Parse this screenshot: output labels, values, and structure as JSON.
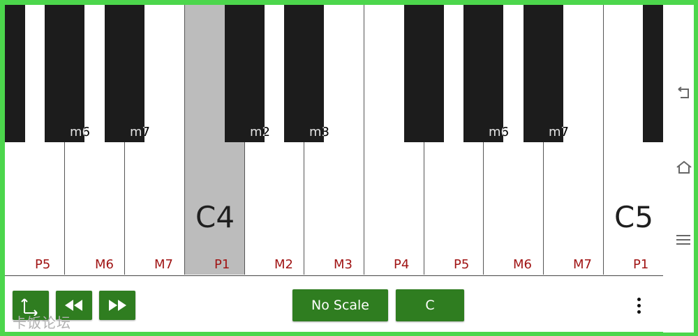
{
  "keyboard": {
    "white_keys": [
      {
        "interval": "P5",
        "note": "",
        "active": false
      },
      {
        "interval": "M6",
        "note": "",
        "active": false
      },
      {
        "interval": "M7",
        "note": "",
        "active": false
      },
      {
        "interval": "P1",
        "note": "C4",
        "active": true
      },
      {
        "interval": "M2",
        "note": "",
        "active": false
      },
      {
        "interval": "M3",
        "note": "",
        "active": false
      },
      {
        "interval": "P4",
        "note": "",
        "active": false
      },
      {
        "interval": "P5",
        "note": "",
        "active": false
      },
      {
        "interval": "M6",
        "note": "",
        "active": false
      },
      {
        "interval": "M7",
        "note": "",
        "active": false
      },
      {
        "interval": "P1",
        "note": "C5",
        "active": false
      }
    ],
    "black_keys": [
      {
        "interval": ""
      },
      {
        "interval": "m6"
      },
      {
        "interval": "m7"
      },
      {
        "interval": "m2"
      },
      {
        "interval": "m3"
      },
      {
        "interval": ""
      },
      {
        "interval": "m6"
      },
      {
        "interval": "m7"
      },
      {
        "interval": ""
      }
    ]
  },
  "toolbar": {
    "axis_button_icon": "axis-icon",
    "rewind_button_icon": "rewind-icon",
    "fast_forward_button_icon": "fast-forward-icon",
    "scale_label": "No Scale",
    "key_label": "C",
    "more_icon": "more-vert-icon"
  },
  "nav": {
    "back_icon": "back-icon",
    "home_icon": "home-icon",
    "menu_icon": "menu-icon"
  },
  "watermark": "卡饭论坛",
  "colors": {
    "frame": "#4cd64c",
    "button": "#2f7d20",
    "interval_text": "#a01414",
    "active_key": "#bcbcbc",
    "black_key": "#1c1c1c"
  }
}
